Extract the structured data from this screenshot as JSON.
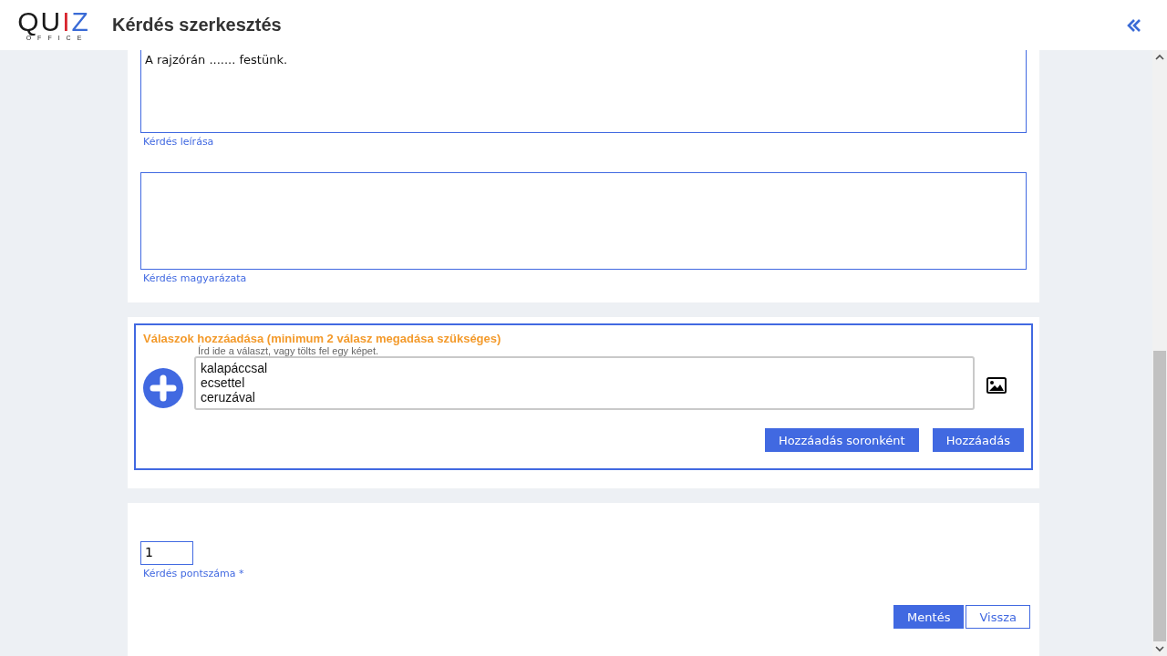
{
  "header": {
    "logo": {
      "word": "QUIZ",
      "sub": "OFFICE"
    },
    "title": "Kérdés szerkesztés"
  },
  "question": {
    "text_value": "A rajzórán ....... festünk.",
    "text_label": "Kérdés leírása",
    "explanation_label": "Kérdés magyarázata"
  },
  "answers": {
    "heading": "Válaszok hozzáadása (minimum 2 válasz megadása szükséges)",
    "hint": "Írd ide a választ, vagy tölts fel egy képet.",
    "lines": [
      "kalapáccsal",
      "ecsettel",
      "ceruzával"
    ],
    "buttons": [
      "Hozzáadás soronként",
      "Hozzáadás"
    ]
  },
  "points": {
    "value": "1",
    "label": "Kérdés pontszáma *"
  },
  "actions": [
    {
      "label": "Mentés",
      "kind": "primary"
    },
    {
      "label": "Vissza",
      "kind": "secondary"
    }
  ]
}
